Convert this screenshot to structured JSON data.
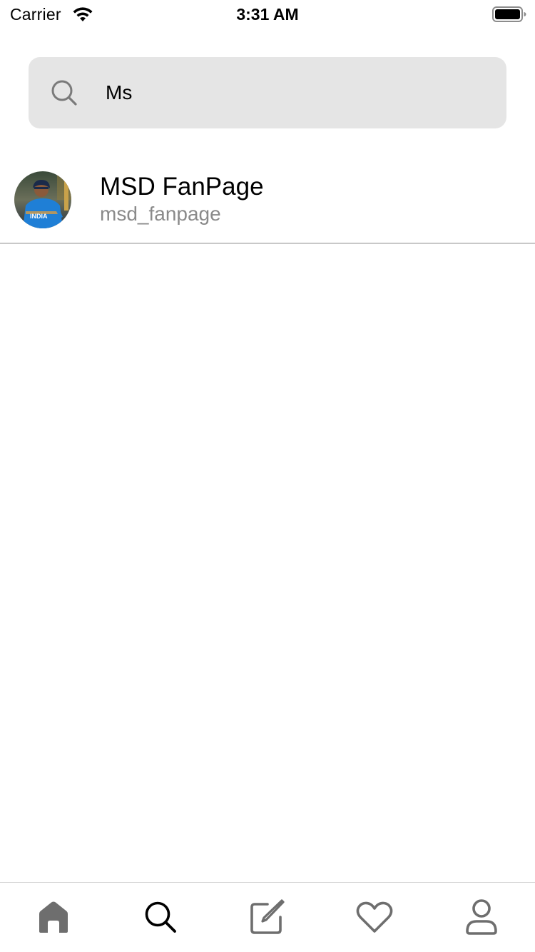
{
  "status_bar": {
    "carrier": "Carrier",
    "time": "3:31 AM"
  },
  "search": {
    "value": "Ms",
    "icon": "search-icon"
  },
  "results": [
    {
      "name": "MSD FanPage",
      "handle": "msd_fanpage",
      "avatar": "profile-photo"
    }
  ],
  "tab_bar": {
    "items": [
      {
        "icon": "home-icon",
        "active": false
      },
      {
        "icon": "search-icon",
        "active": true
      },
      {
        "icon": "compose-icon",
        "active": false
      },
      {
        "icon": "heart-icon",
        "active": false
      },
      {
        "icon": "profile-icon",
        "active": false
      }
    ]
  },
  "colors": {
    "search_bg": "#e5e5e5",
    "secondary_text": "#8a8a8a",
    "inactive_icon": "#6e6e6e",
    "active_icon": "#000000",
    "divider": "#c8c8c8"
  }
}
